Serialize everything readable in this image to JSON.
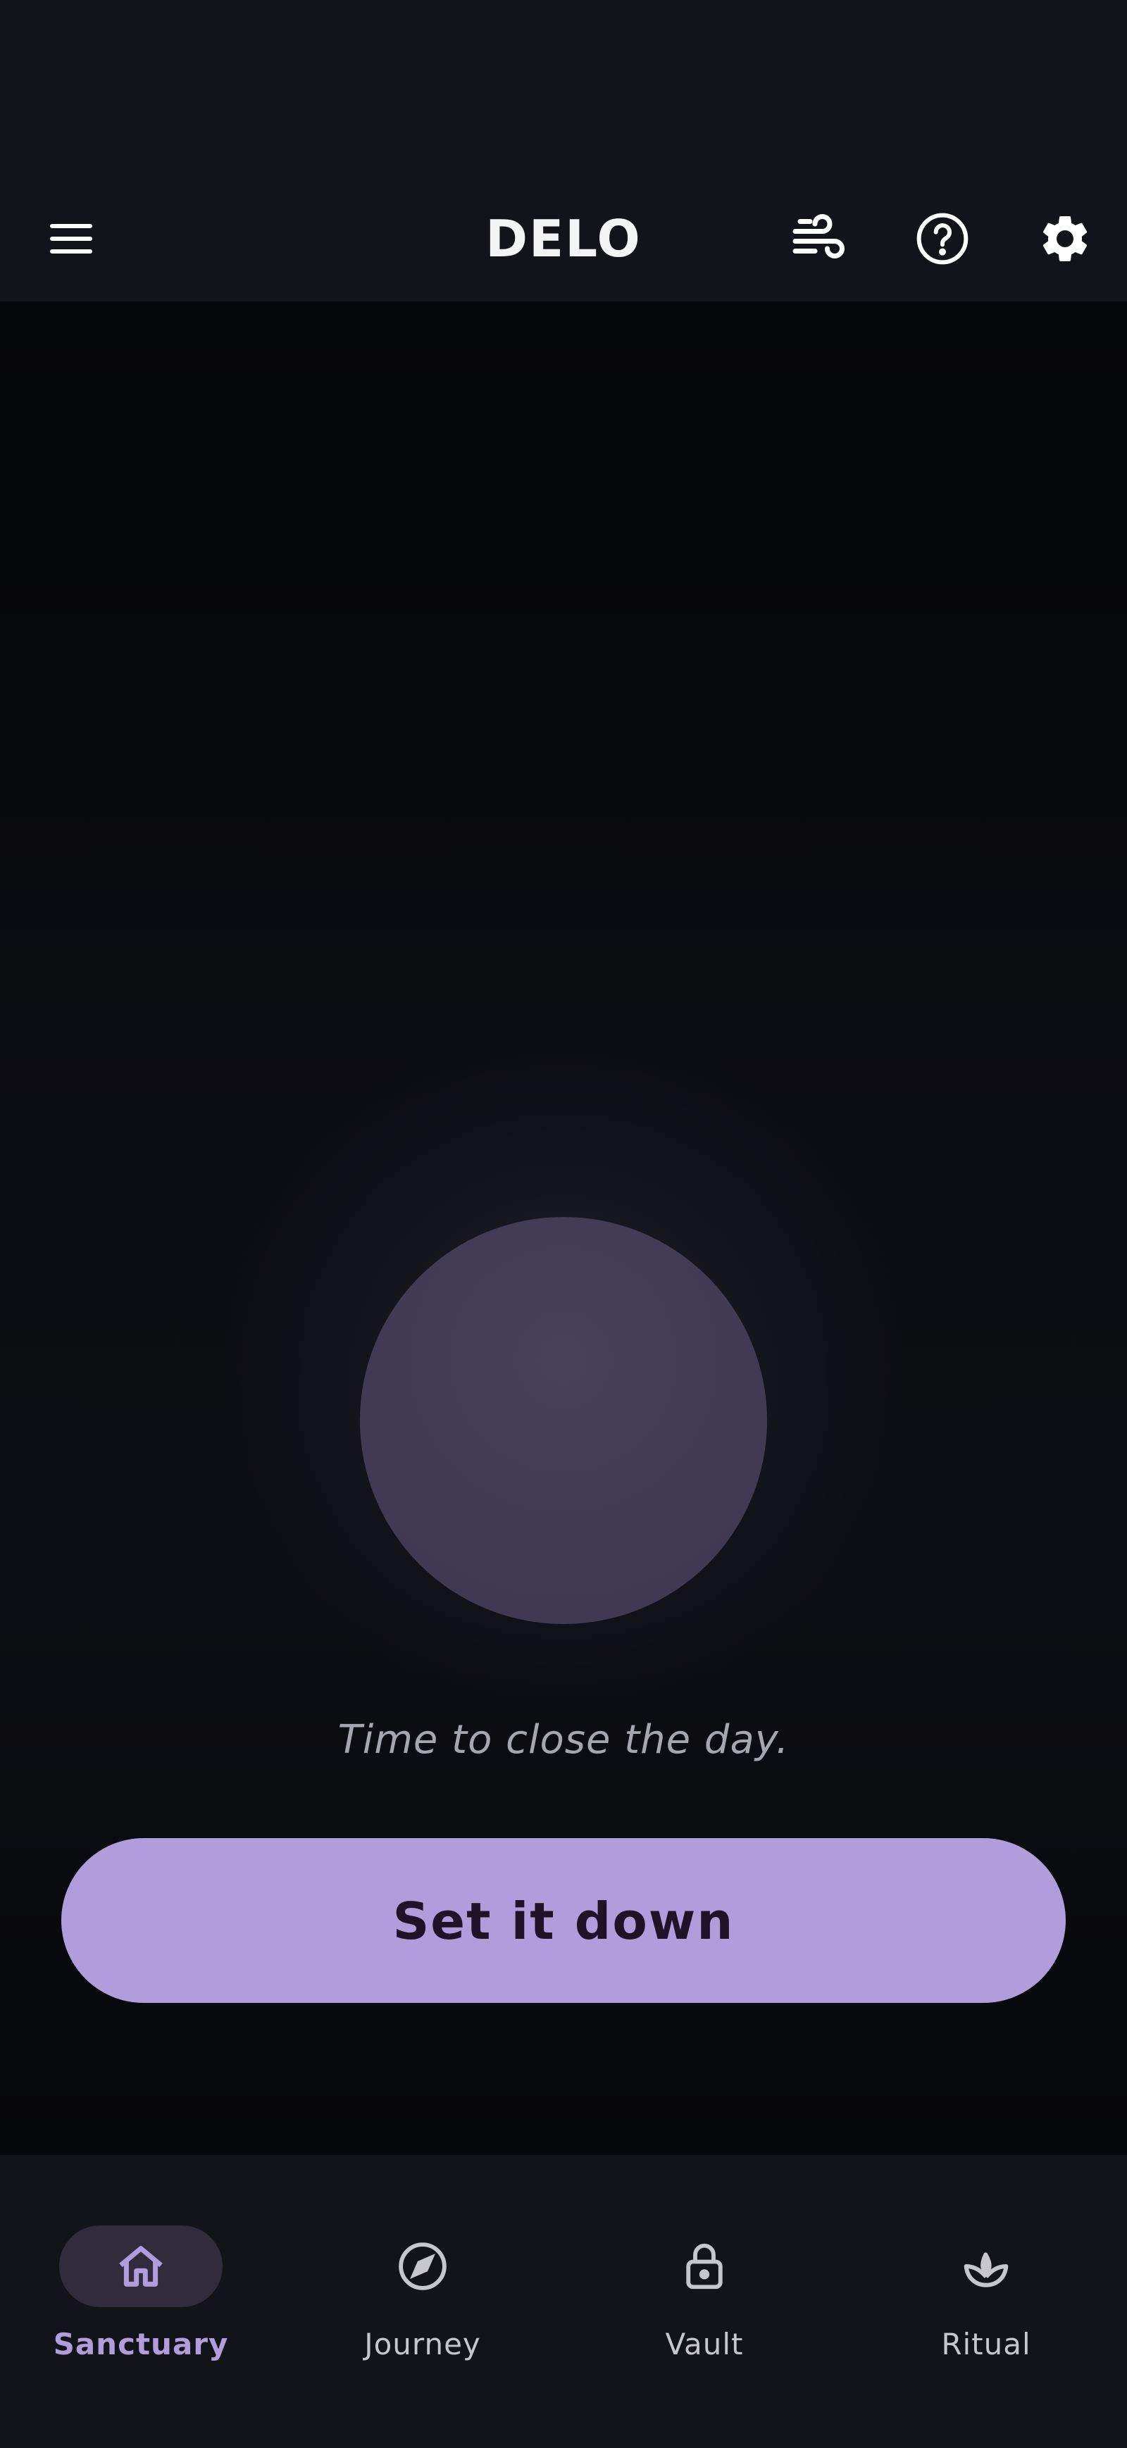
{
  "header": {
    "title": "DELO",
    "icons": {
      "menu": "menu-icon",
      "breath": "wind-icon",
      "help": "help-icon",
      "settings": "gear-icon"
    }
  },
  "main": {
    "prompt": "Time to close the day.",
    "primary_action": "Set it down"
  },
  "bottom_nav": {
    "items": [
      {
        "label": "Sanctuary",
        "icon": "home-icon",
        "active": true
      },
      {
        "label": "Journey",
        "icon": "compass-icon",
        "active": false
      },
      {
        "label": "Vault",
        "icon": "lock-icon",
        "active": false
      },
      {
        "label": "Ritual",
        "icon": "sprout-icon",
        "active": false
      }
    ]
  },
  "colors": {
    "accent": "#b09ddb",
    "background": "#131419",
    "orb": "#413a53",
    "text_muted": "#a6a6ae"
  }
}
